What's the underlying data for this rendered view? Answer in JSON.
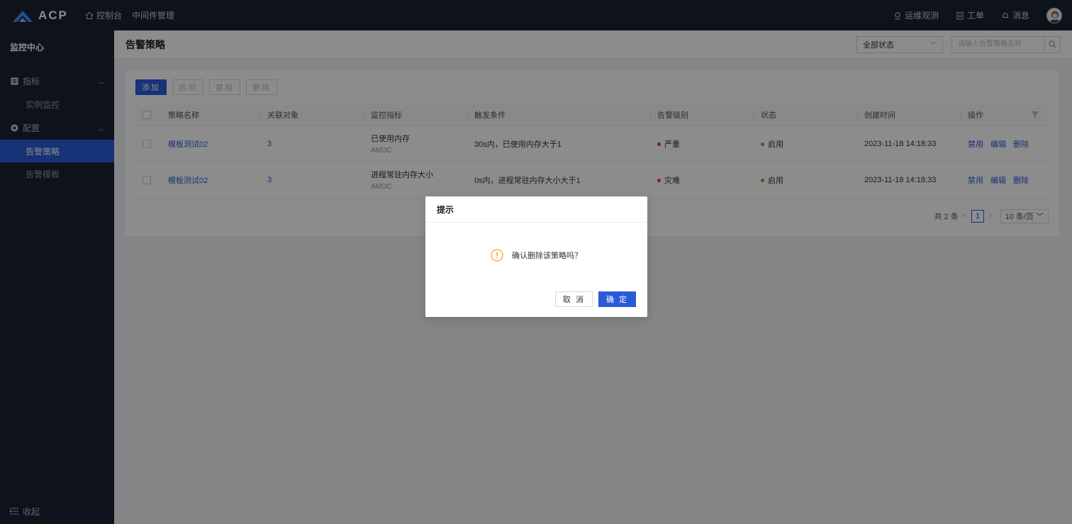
{
  "app": {
    "logo_text": "ACP",
    "nav": [
      {
        "label": "控制台",
        "icon": "home-icon"
      },
      {
        "label": "中间件管理"
      }
    ],
    "right": [
      {
        "label": "运维观测",
        "icon": "location-pin-icon"
      },
      {
        "label": "工单",
        "icon": "clipboard-icon"
      },
      {
        "label": "消息",
        "icon": "bell-icon"
      }
    ]
  },
  "sidebar": {
    "title": "监控中心",
    "groups": [
      {
        "label": "指标",
        "icon": "list-icon",
        "items": [
          "实例监控"
        ]
      },
      {
        "label": "配置",
        "icon": "gear-icon",
        "items": [
          "告警策略",
          "告警模板"
        ]
      }
    ],
    "active": "告警策略",
    "collapse_label": "收起"
  },
  "header": {
    "title": "告警策略",
    "status_select": "全部状态",
    "search_placeholder": "请输入告警策略名称"
  },
  "toolbar": {
    "add": "添加",
    "enable": "启用",
    "disable": "禁用",
    "delete": "删除"
  },
  "table": {
    "columns": [
      "策略名称",
      "关联对象",
      "监控指标",
      "触发条件",
      "告警级别",
      "状态",
      "创建时间",
      "操作"
    ],
    "rows": [
      {
        "name": "模板测试02",
        "objects": "3",
        "metric": "已使用内存",
        "metric_sub": "AMDC",
        "condition": "30s内，已使用内存大于1",
        "level": "严重",
        "level_color": "#e53935",
        "status": "启用",
        "status_color": "#52c41a",
        "created": "2023-11-18 14:18:33",
        "ops": [
          "禁用",
          "编辑",
          "删除"
        ]
      },
      {
        "name": "模板测试02",
        "objects": "3",
        "metric": "进程常驻内存大小",
        "metric_sub": "AMDC",
        "condition": "0s内，进程常驻内存大小大于1",
        "level": "灾难",
        "level_color": "#e53935",
        "status": "启用",
        "status_color": "#52c41a",
        "created": "2023-11-18 14:18:33",
        "ops": [
          "禁用",
          "编辑",
          "删除"
        ]
      }
    ]
  },
  "pagination": {
    "total": "共 2 条",
    "current": "1",
    "page_size": "10 条/页"
  },
  "dialog": {
    "title": "提示",
    "message": "确认删除该策略吗？",
    "cancel": "取 消",
    "ok": "确 定",
    "warn_color": "#f5a623"
  },
  "colors": {
    "primary": "#2a5bd7",
    "topbar": "#1b2232"
  }
}
